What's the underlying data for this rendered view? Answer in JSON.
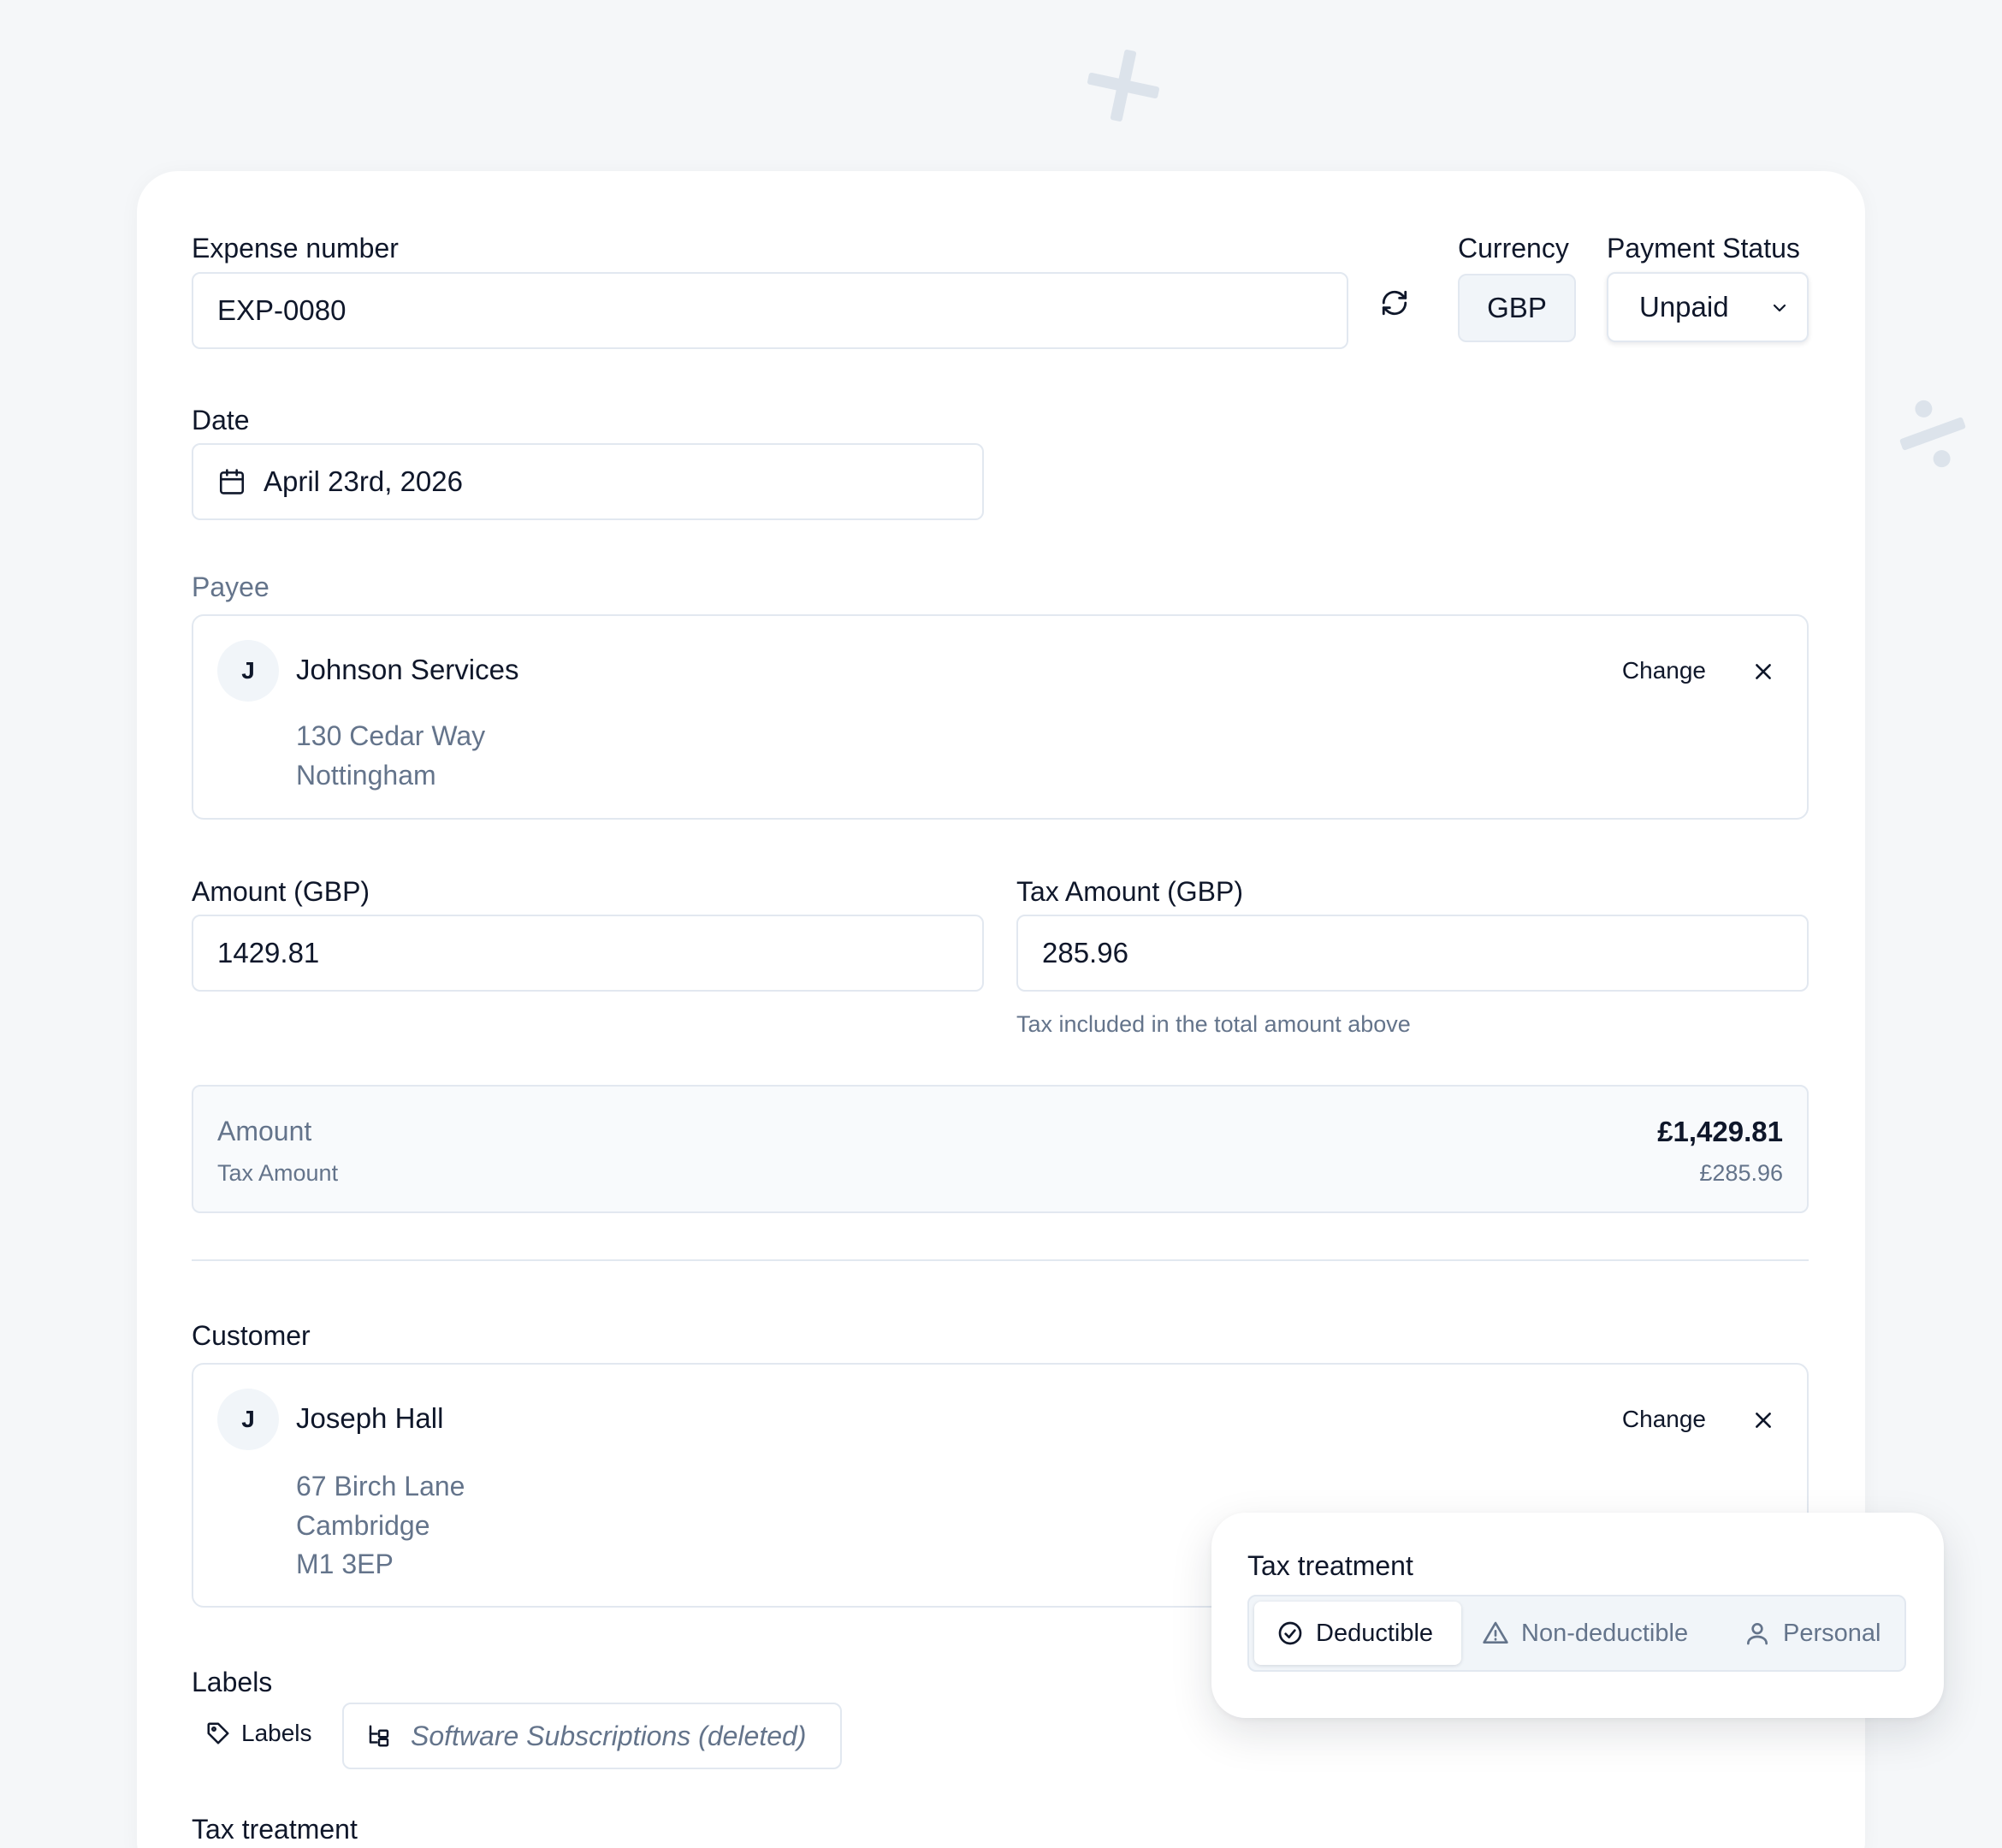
{
  "expense": {
    "number_label": "Expense number",
    "number_value": "EXP-0080",
    "currency_label": "Currency",
    "currency_value": "GBP",
    "status_label": "Payment Status",
    "status_value": "Unpaid",
    "date_label": "Date",
    "date_value": "April 23rd, 2026"
  },
  "payee": {
    "section_label": "Payee",
    "initial": "J",
    "name": "Johnson Services",
    "address_lines": [
      "130 Cedar Way",
      "Nottingham"
    ],
    "change_label": "Change"
  },
  "amounts": {
    "amount_label": "Amount (GBP)",
    "amount_value": "1429.81",
    "tax_label": "Tax Amount (GBP)",
    "tax_value": "285.96",
    "tax_hint": "Tax included in the total amount above"
  },
  "summary": {
    "amount_label": "Amount",
    "amount_value": "£1,429.81",
    "tax_label": "Tax Amount",
    "tax_value": "£285.96"
  },
  "customer": {
    "section_label": "Customer",
    "initial": "J",
    "name": "Joseph Hall",
    "address_lines": [
      "67 Birch Lane",
      "Cambridge",
      "M1 3EP"
    ],
    "change_label": "Change"
  },
  "labels": {
    "section_label": "Labels",
    "button_label": "Labels",
    "chip_text": "Software Subscriptions (deleted)"
  },
  "tax_treatment": {
    "section_label": "Tax treatment",
    "popover_title": "Tax treatment",
    "options": [
      {
        "label": "Deductible",
        "icon": "check-circle-icon",
        "active": true
      },
      {
        "label": "Non-deductible",
        "icon": "warning-icon",
        "active": false
      },
      {
        "label": "Personal",
        "icon": "user-icon",
        "active": false
      }
    ]
  },
  "colors": {
    "text": "#0f172a",
    "muted": "#64748b",
    "border": "#e2e8f0",
    "background": "#f5f7f9"
  }
}
